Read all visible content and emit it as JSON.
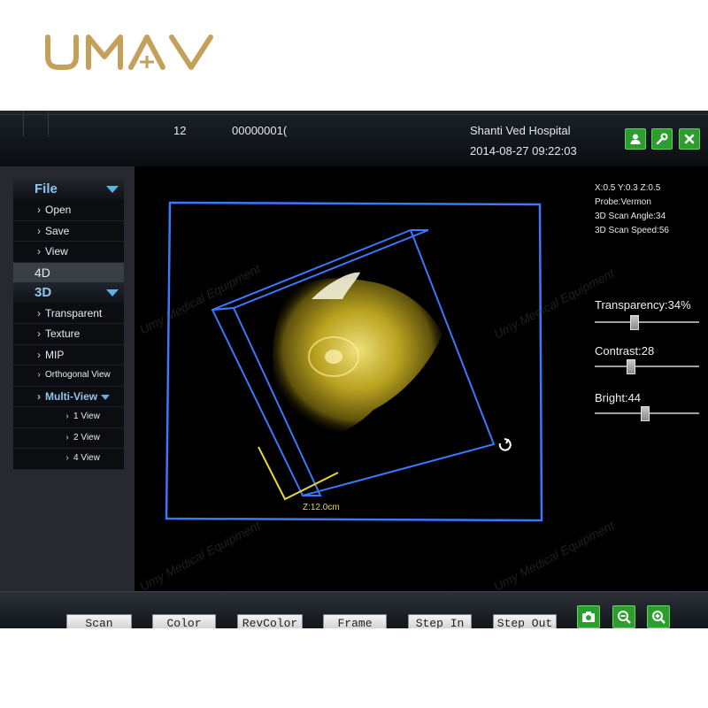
{
  "logo": {
    "text": "UMAY"
  },
  "header": {
    "field_a": "12",
    "field_b": "00000001(",
    "hospital": "Shanti Ved  Hospital",
    "datetime": "2014-08-27 09:22:03",
    "buttons": [
      {
        "icon": "user-icon"
      },
      {
        "icon": "wrench-icon"
      },
      {
        "icon": "close-icon"
      }
    ]
  },
  "menu": {
    "file": {
      "label": "File",
      "items": [
        "Open",
        "Save",
        "View"
      ]
    },
    "four_d": {
      "label": "4D"
    },
    "three_d": {
      "label": "3D",
      "items": [
        "Transparent",
        "Texture",
        "MIP",
        "Orthogonal View"
      ]
    },
    "multi_view": {
      "label": "Multi-View",
      "items": [
        "1 View",
        "2 View",
        "4 View"
      ]
    }
  },
  "scan_info": {
    "xyz": "X:0.5 Y:0.3 Z:0.5",
    "probe": "Probe:Vermon",
    "angle": "3D Scan Angle:34",
    "speed": "3D Scan Speed:56"
  },
  "controls": {
    "transparency": {
      "label": "Transparency:34%",
      "value": 34
    },
    "contrast": {
      "label": "Contrast:28",
      "value": 28
    },
    "bright": {
      "label": "Bright:44",
      "value": 44
    }
  },
  "measure": {
    "label": "Z:12.0cm"
  },
  "bottom": {
    "buttons": [
      "Scan",
      "Color",
      "RevColor",
      "Frame",
      "Step In",
      "Step Out"
    ],
    "icon_buttons": [
      "camera-icon",
      "zoom-out-icon",
      "zoom-in-icon"
    ]
  },
  "watermark": {
    "text": "UMAY",
    "sub": "Umy Medical Equipment"
  },
  "colors": {
    "accent_blue": "#3a78ff",
    "menu_head": "#8fc6ec",
    "button_green": "#2e9c2e",
    "scan_yellow": "#d6c33a"
  }
}
